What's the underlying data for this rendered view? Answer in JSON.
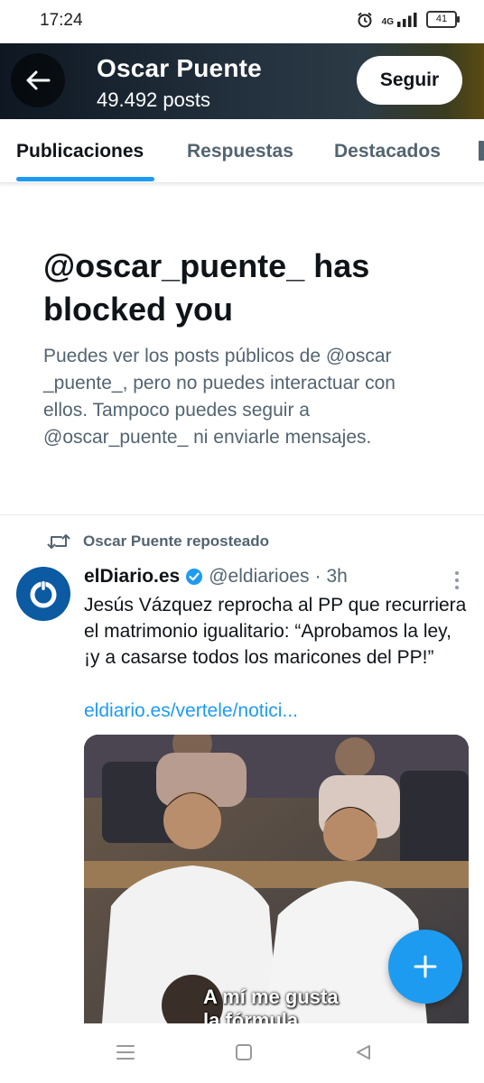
{
  "status_bar": {
    "time": "17:24",
    "network": "4G",
    "battery": "41"
  },
  "profile": {
    "name": "Oscar Puente",
    "posts": "49.492 posts",
    "follow_label": "Seguir"
  },
  "tabs": [
    {
      "label": "Publicaciones",
      "active": true
    },
    {
      "label": "Respuestas",
      "active": false
    },
    {
      "label": "Destacados",
      "active": false
    }
  ],
  "blocked": {
    "title": "@oscar_puente_ has blocked you",
    "description": "Puedes ver los posts públicos de @oscar _puente_, pero no puedes interactuar con ellos. Tampoco puedes seguir a @oscar_puente_ ni enviarle mensajes."
  },
  "tweet": {
    "repost_label": "Oscar Puente reposteado",
    "author_name": "elDiario.es",
    "author_handle": "@eldiarioes",
    "separator": "·",
    "time": "3h",
    "text": "Jesús Vázquez reprocha al PP que recurriera el matrimonio igualitario: “Aprobamos la ley, ¡y a casarse todos los maricones del PP!”",
    "link": "eldiario.es/vertele/notici...",
    "media_caption_line1": "A mí me gusta",
    "media_caption_line2": "la fórmula"
  },
  "colors": {
    "accent": "#1d9bf0",
    "text_primary": "#0f1419",
    "text_secondary": "#536471",
    "avatar_bg": "#0b5aa2"
  },
  "icons": [
    "back-arrow-icon",
    "repost-icon",
    "verified-badge-icon",
    "more-options-icon",
    "plus-icon",
    "nav-recents-icon",
    "nav-home-icon",
    "nav-back-icon",
    "alarm-icon",
    "signal-icon",
    "battery-icon"
  ]
}
